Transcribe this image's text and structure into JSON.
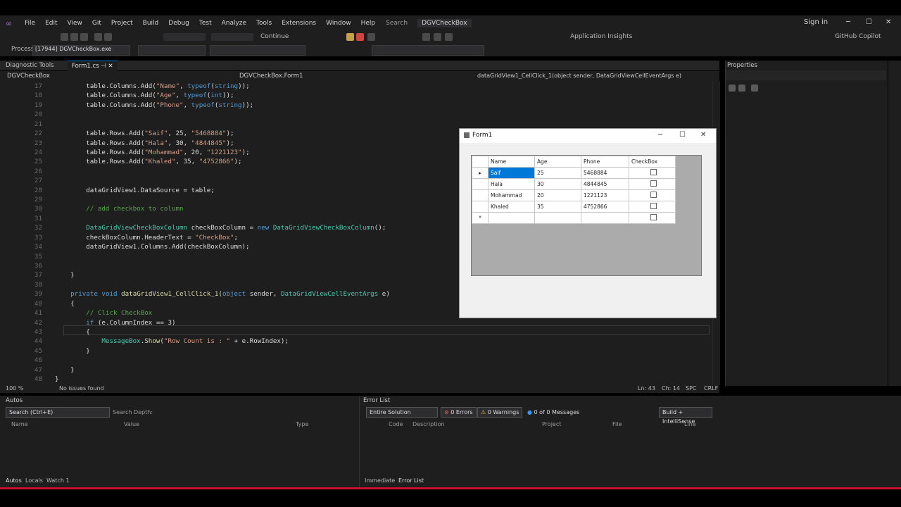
{
  "menu": {
    "items": [
      "File",
      "Edit",
      "View",
      "Git",
      "Project",
      "Build",
      "Debug",
      "Test",
      "Analyze",
      "Tools",
      "Extensions",
      "Window",
      "Help"
    ],
    "search": "Search",
    "project": "DGVCheckBox",
    "signin": "Sign in"
  },
  "toolbar": {
    "continue": "Continue",
    "app_insights": "Application Insights",
    "github_copilot": "GitHub Copilot",
    "process_label": "Process:",
    "process_value": "[17944] DGVCheckBox.exe"
  },
  "tabs": {
    "diag": "Diagnostic Tools",
    "file": "Form1.cs",
    "properties": "Properties"
  },
  "navbar": {
    "project": "DGVCheckBox",
    "class": "DGVCheckBox.Form1",
    "member": "dataGridView1_CellClick_1(object sender, DataGridViewCellEventArgs e)"
  },
  "code": [
    {
      "n": "17",
      "html": "        table.Columns.Add(<span class='s'>\"Name\"</span>, <span class='k'>typeof</span>(<span class='k'>string</span>));"
    },
    {
      "n": "18",
      "html": "        table.Columns.Add(<span class='s'>\"Age\"</span>, <span class='k'>typeof</span>(<span class='k'>int</span>));"
    },
    {
      "n": "19",
      "html": "        table.Columns.Add(<span class='s'>\"Phone\"</span>, <span class='k'>typeof</span>(<span class='k'>string</span>));"
    },
    {
      "n": "20",
      "html": ""
    },
    {
      "n": "21",
      "html": ""
    },
    {
      "n": "22",
      "html": "        table.Rows.Add(<span class='s'>\"Saif\"</span>, 25, <span class='s'>\"5468884\"</span>);"
    },
    {
      "n": "23",
      "html": "        table.Rows.Add(<span class='s'>\"Hala\"</span>, 30, <span class='s'>\"4844845\"</span>);"
    },
    {
      "n": "24",
      "html": "        table.Rows.Add(<span class='s'>\"Mohammad\"</span>, 20, <span class='s'>\"1221123\"</span>);"
    },
    {
      "n": "25",
      "html": "        table.Rows.Add(<span class='s'>\"Khaled\"</span>, 35, <span class='s'>\"4752866\"</span>);"
    },
    {
      "n": "26",
      "html": ""
    },
    {
      "n": "27",
      "html": ""
    },
    {
      "n": "28",
      "html": "        dataGridView1.DataSource = table;"
    },
    {
      "n": "29",
      "html": ""
    },
    {
      "n": "30",
      "html": "        <span class='c'>// add checkbox to column</span>"
    },
    {
      "n": "31",
      "html": ""
    },
    {
      "n": "32",
      "html": "        <span class='t'>DataGridViewCheckBoxColumn</span> checkBoxColumn = <span class='k'>new</span> <span class='t'>DataGridViewCheckBoxColumn</span>();"
    },
    {
      "n": "33",
      "html": "        checkBoxColumn.HeaderText = <span class='s'>\"CheckBox\"</span>;"
    },
    {
      "n": "34",
      "html": "        dataGridView1.Columns.Add(checkBoxColumn);"
    },
    {
      "n": "35",
      "html": ""
    },
    {
      "n": "36",
      "html": ""
    },
    {
      "n": "37",
      "html": "    }"
    },
    {
      "n": "38",
      "html": ""
    },
    {
      "n": "39",
      "html": "    <span class='k'>private</span> <span class='k'>void</span> <span class='m'>dataGridView1_CellClick_1</span>(<span class='k'>object</span> sender, <span class='t'>DataGridViewCellEventArgs</span> e)"
    },
    {
      "n": "40",
      "html": "    {"
    },
    {
      "n": "41",
      "html": "        <span class='c'>// Click CheckBox</span>"
    },
    {
      "n": "42",
      "html": "        <span class='k'>if</span> (e.ColumnIndex == 3)"
    },
    {
      "n": "43",
      "html": "        {"
    },
    {
      "n": "44",
      "html": "            <span class='t'>MessageBox</span>.<span class='m'>Show</span>(<span class='s'>\"Row Count is : \"</span> + e.RowIndex);"
    },
    {
      "n": "45",
      "html": "        }"
    },
    {
      "n": "46",
      "html": ""
    },
    {
      "n": "47",
      "html": "    }"
    },
    {
      "n": "48",
      "html": "}"
    }
  ],
  "statusbar": {
    "zoom": "100 %",
    "issues": "No issues found",
    "ln": "Ln: 43",
    "ch": "Ch: 14",
    "spc": "SPC",
    "crlf": "CRLF"
  },
  "form1": {
    "title": "Form1",
    "headers": [
      "Name",
      "Age",
      "Phone",
      "CheckBox"
    ],
    "rows": [
      [
        "Saif",
        "25",
        "5468884"
      ],
      [
        "Hala",
        "30",
        "4844845"
      ],
      [
        "Mohammad",
        "20",
        "1221123"
      ],
      [
        "Khaled",
        "35",
        "4752866"
      ]
    ]
  },
  "autos": {
    "title": "Autos",
    "search": "Search (Ctrl+E)",
    "depth": "Search Depth:",
    "cols": [
      "Name",
      "Value",
      "Type"
    ],
    "tabs": [
      "Autos",
      "Locals",
      "Watch 1"
    ]
  },
  "errors": {
    "title": "Error List",
    "scope": "Entire Solution",
    "errors": "0 Errors",
    "warnings": "0 Warnings",
    "messages": "0 of 0 Messages",
    "build": "Build + IntelliSense",
    "cols": [
      "Code",
      "Description",
      "Project",
      "File",
      "Line"
    ],
    "tabs": [
      "Immediate",
      "Error List"
    ]
  }
}
